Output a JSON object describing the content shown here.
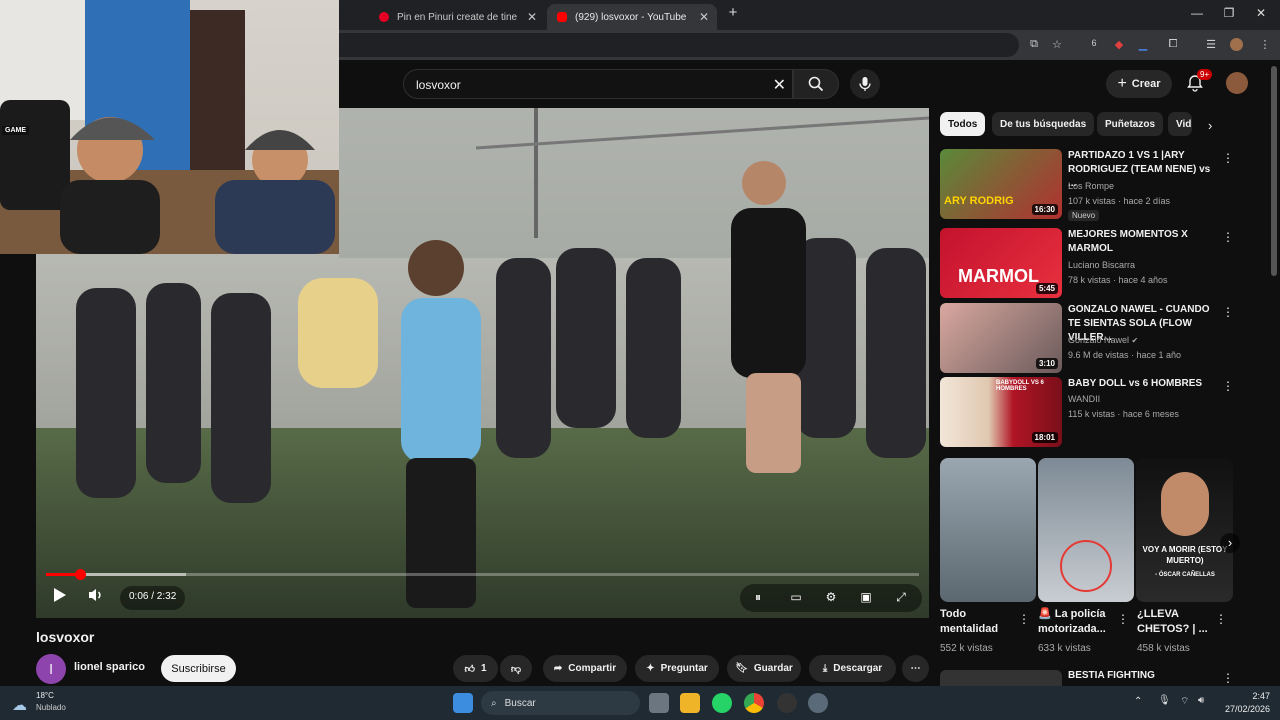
{
  "browser": {
    "tabs": [
      {
        "label": "Pin en Pinuri create de tine",
        "active": false
      },
      {
        "label": "(929) losvoxor - YouTube",
        "active": true
      }
    ],
    "extension_count": "6"
  },
  "youtube": {
    "search_query": "losvoxor",
    "create_label": "Crear",
    "notification_badge": "9+"
  },
  "player": {
    "time": "0:06 / 2:32",
    "progress_fraction": 0.039,
    "buffered_fraction": 0.16
  },
  "video": {
    "title": "losvoxor",
    "channel_initial": "l",
    "channel_name": "lionel sparico",
    "subscribe_label": "Suscribirse",
    "like_count": "1",
    "share_label": "Compartir",
    "ask_label": "Preguntar",
    "save_label": "Guardar",
    "download_label": "Descargar"
  },
  "sidebar": {
    "chips": [
      "Todos",
      "De tus búsquedas",
      "Puñetazos",
      "Vid"
    ],
    "recommendations": [
      {
        "title": "PARTIDAZO 1 VS 1 |ARY RODRIGUEZ (TEAM NENE) vs ...",
        "channel": "Los Rompe",
        "meta": "107 k vistas · hace 2 días",
        "badge": "Nuevo",
        "duration": "16:30",
        "thumb_text": "ARY RODRIG"
      },
      {
        "title": "MEJORES MOMENTOS X MARMOL",
        "channel": "Luciano Biscarra",
        "meta": "78 k vistas · hace 4 años",
        "badge": "",
        "duration": "5:45",
        "thumb_text": "MARMOL"
      },
      {
        "title": "GONZALO NAWEL - CUANDO TE SIENTAS SOLA (FLOW VILLER...",
        "channel": "Gonzalo Nawel",
        "meta": "9.6 M de vistas · hace 1 año",
        "badge": "",
        "duration": "3:10",
        "thumb_text": ""
      },
      {
        "title": "BABY DOLL vs 6 HOMBRES",
        "channel": "WANDII",
        "meta": "115 k vistas · hace 6 meses",
        "badge": "",
        "duration": "18:01",
        "thumb_text": "BABYDOLL VS 6 HOMBRES"
      }
    ],
    "shorts": [
      {
        "title": "Todo mentalidad",
        "views": "552 k vistas"
      },
      {
        "title": "🚨 La policía motorizada...",
        "views": "633 k vistas"
      },
      {
        "title": "¿LLEVA CHETOS? | ...",
        "views": "458 k vistas",
        "overlay": "VOY A MORIR (ESTOY MUERTO)",
        "overlay_sub": "- ÓSCAR CAÑELLAS"
      }
    ],
    "next_title": "BESTIA FIGHTING"
  },
  "webcam": {
    "tag": "GAME"
  },
  "taskbar": {
    "weather_temp": "18°C",
    "weather_desc": "Nublado",
    "search_label": "Buscar",
    "time": "2:47",
    "date": "27/02/2026"
  }
}
